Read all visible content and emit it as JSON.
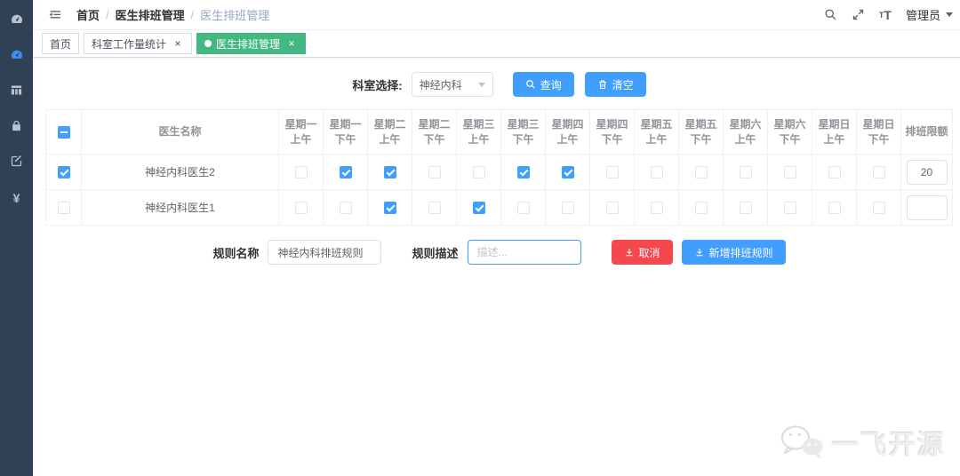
{
  "sidebar": {
    "items": [
      {
        "icon": "dashboard-icon",
        "active": false
      },
      {
        "icon": "monitor-dashboard-icon",
        "active": true
      },
      {
        "icon": "table-icon",
        "active": false
      },
      {
        "icon": "lock-icon",
        "active": false
      },
      {
        "icon": "edit-icon",
        "active": false
      },
      {
        "icon": "money-icon",
        "active": false
      }
    ]
  },
  "navbar": {
    "breadcrumb": [
      {
        "label": "首页",
        "current": false
      },
      {
        "label": "医生排班管理",
        "current": false
      },
      {
        "label": "医生排班管理",
        "current": true
      }
    ],
    "separator": "/",
    "user_label": "管理员"
  },
  "tags_view": {
    "close_glyph": "×",
    "tabs": [
      {
        "label": "首页",
        "closable": false,
        "active": false
      },
      {
        "label": "科室工作量统计",
        "closable": true,
        "active": false
      },
      {
        "label": "医生排班管理",
        "closable": true,
        "active": true
      }
    ]
  },
  "filter": {
    "label": "科室选择:",
    "select_value": "神经内科",
    "query_button": "查询",
    "clear_button": "清空"
  },
  "table": {
    "name_header": "医生名称",
    "limit_header": "排班限额",
    "header_checkbox_state": "indeterminate",
    "day_columns": [
      {
        "line1": "星期一",
        "line2": "上午"
      },
      {
        "line1": "星期一",
        "line2": "下午"
      },
      {
        "line1": "星期二",
        "line2": "上午"
      },
      {
        "line1": "星期二",
        "line2": "下午"
      },
      {
        "line1": "星期三",
        "line2": "上午"
      },
      {
        "line1": "星期三",
        "line2": "下午"
      },
      {
        "line1": "星期四",
        "line2": "上午"
      },
      {
        "line1": "星期四",
        "line2": "下午"
      },
      {
        "line1": "星期五",
        "line2": "上午"
      },
      {
        "line1": "星期五",
        "line2": "下午"
      },
      {
        "line1": "星期六",
        "line2": "上午"
      },
      {
        "line1": "星期六",
        "line2": "下午"
      },
      {
        "line1": "星期日",
        "line2": "上午"
      },
      {
        "line1": "星期日",
        "line2": "下午"
      }
    ],
    "rows": [
      {
        "name": "神经内科医生2",
        "selected": true,
        "slots": [
          false,
          true,
          true,
          false,
          false,
          true,
          true,
          false,
          false,
          false,
          false,
          false,
          false,
          false
        ],
        "limit": "20"
      },
      {
        "name": "神经内科医生1",
        "selected": false,
        "slots": [
          false,
          false,
          true,
          false,
          true,
          false,
          false,
          false,
          false,
          false,
          false,
          false,
          false,
          false
        ],
        "limit": ""
      }
    ]
  },
  "rule_form": {
    "name_label": "规则名称",
    "name_value": "神经内科排班规则",
    "desc_label": "规则描述",
    "desc_placeholder": "描述...",
    "cancel_button": "取消",
    "submit_button": "新增排班规则"
  },
  "watermark": {
    "text": "一飞开源"
  },
  "colors": {
    "accent_blue": "#409eff",
    "active_tab_green": "#42b983",
    "danger_red": "#f5484d",
    "sidebar_bg": "#304156"
  }
}
